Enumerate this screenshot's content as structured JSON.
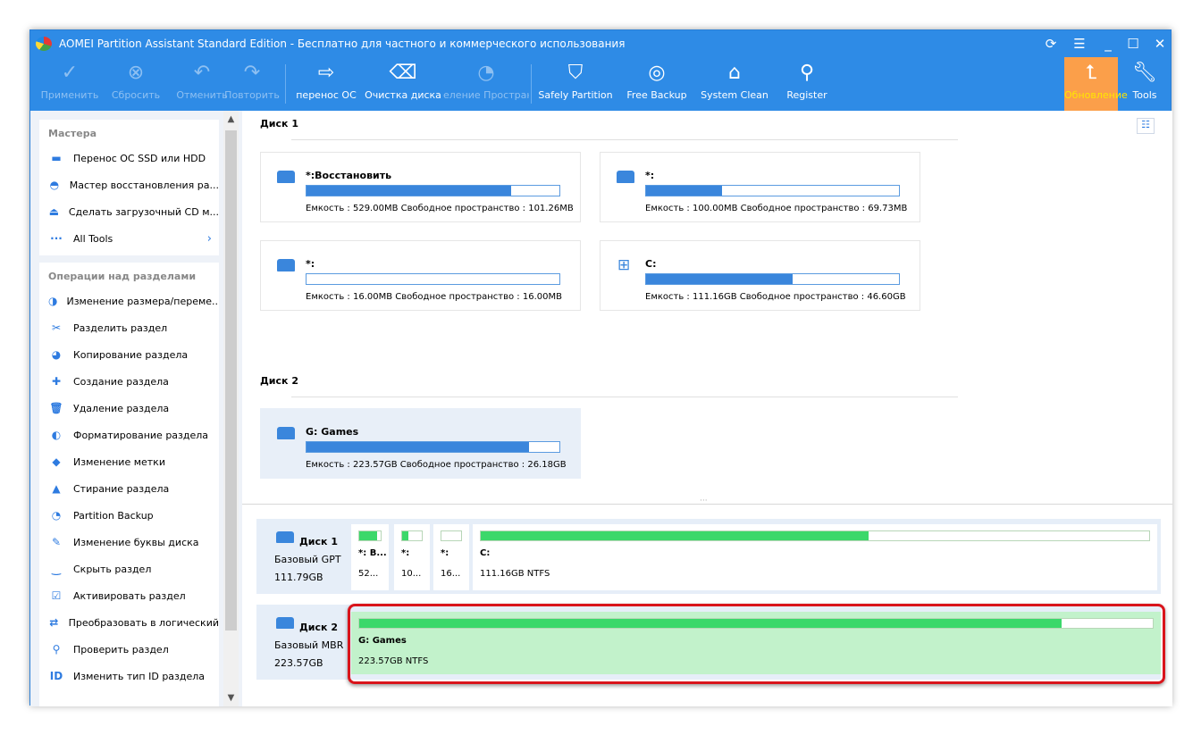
{
  "title": "AOMEI Partition Assistant Standard Edition - Бесплатно для частного и коммерческого использования",
  "toolbar": [
    {
      "label": "Применить",
      "icon": "check-icon",
      "enabled": false
    },
    {
      "label": "Сбросить",
      "icon": "discard-icon",
      "enabled": false
    },
    {
      "label": "Отменить",
      "icon": "undo-icon",
      "enabled": false
    },
    {
      "label": "Повторить",
      "icon": "redo-icon",
      "enabled": false
    },
    {
      "label": "перенос ОС",
      "icon": "migrate-os-icon",
      "enabled": true
    },
    {
      "label": "Очистка диска",
      "icon": "disk-wipe-icon",
      "enabled": true
    },
    {
      "label": "еление Пространс",
      "icon": "space-allocate-icon",
      "enabled": false
    },
    {
      "label": "Safely Partition",
      "icon": "shield-icon",
      "enabled": true
    },
    {
      "label": "Free Backup",
      "icon": "backup-icon",
      "enabled": true
    },
    {
      "label": "System Clean",
      "icon": "clean-icon",
      "enabled": true
    },
    {
      "label": "Register",
      "icon": "register-icon",
      "enabled": true
    },
    {
      "label": "Обновление",
      "icon": "upgrade-icon",
      "enabled": true
    },
    {
      "label": "Tools",
      "icon": "wrench-icon",
      "enabled": true
    }
  ],
  "wizards": {
    "title": "Мастера",
    "items": [
      "Перенос ОС SSD или HDD",
      "Мастер восстановления ра...",
      "Сделать загрузочный CD м...",
      "All Tools"
    ]
  },
  "operations": {
    "title": "Операции над разделами",
    "items": [
      "Изменение размера/переме...",
      "Разделить раздел",
      "Копирование раздела",
      "Создание раздела",
      "Удаление раздела",
      "Форматирование раздела",
      "Изменение метки",
      "Стирание раздела",
      "Partition Backup",
      "Изменение буквы диска",
      "Скрыть раздел",
      "Активировать раздел",
      "Преобразовать в логический",
      "Проверить раздел",
      "Изменить тип ID раздела"
    ]
  },
  "disks": [
    {
      "title": "Диск 1",
      "partitions": [
        {
          "name": "*:Восстановить",
          "info": "Емкость : 529.00MB Свободное пространство : 101.26MB",
          "used": 0.81
        },
        {
          "name": "*:",
          "info": "Емкость : 100.00MB  Свободное пространство : 69.73MB",
          "used": 0.3
        },
        {
          "name": "*:",
          "info": "Емкость : 16.00MB   Свободное пространство : 16.00MB",
          "used": 0.0
        },
        {
          "name": "C:",
          "info": "Емкость : 111.16GB  Свободное пространство : 46.60GB",
          "used": 0.58
        }
      ]
    },
    {
      "title": "Диск 2",
      "partitions": [
        {
          "name": "G: Games",
          "info": "Емкость : 223.57GB  Свободное пространство : 26.18GB",
          "used": 0.88
        }
      ]
    }
  ],
  "diskmap": [
    {
      "name": "Диск 1",
      "type": "Базовый GPT",
      "size": "111.79GB",
      "parts": [
        {
          "name": "*: В...",
          "size": "52...",
          "used": 0.85
        },
        {
          "name": "*:",
          "size": "10...",
          "used": 0.3
        },
        {
          "name": "*:",
          "size": "16...",
          "used": 0.0
        },
        {
          "name": "C:",
          "size": "111.16GB NTFS",
          "used": 0.58
        }
      ]
    },
    {
      "name": "Диск 2",
      "type": "Базовый MBR",
      "size": "223.57GB",
      "parts": [
        {
          "name": "G:  Games",
          "size": "223.57GB NTFS",
          "used": 0.885
        }
      ]
    }
  ]
}
